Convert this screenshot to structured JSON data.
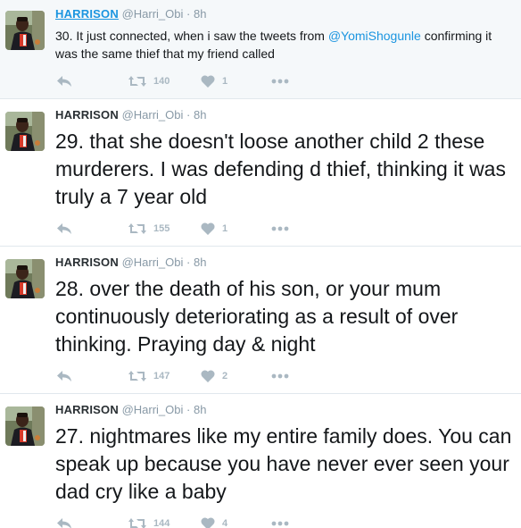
{
  "tweets": [
    {
      "name": "HARRISON",
      "handle": "@Harri_Obi",
      "separator": "·",
      "time": "8h",
      "text_before": "30. It just connected, when i saw the tweets from ",
      "mention": "@YomiShogunle",
      "text_after": " confirming it was the same thief that my friend called",
      "retweets": "140",
      "likes": "1"
    },
    {
      "name": "HARRISON",
      "handle": "@Harri_Obi",
      "separator": "·",
      "time": "8h",
      "text": "29. that she doesn't loose another child 2 these murderers. I was defending d thief, thinking it was truly a 7 year old",
      "retweets": "155",
      "likes": "1"
    },
    {
      "name": "HARRISON",
      "handle": "@Harri_Obi",
      "separator": "·",
      "time": "8h",
      "text": "28. over the death of his son, or your mum continuously deteriorating as a result of over thinking. Praying day & night",
      "retweets": "147",
      "likes": "2"
    },
    {
      "name": "HARRISON",
      "handle": "@Harri_Obi",
      "separator": "·",
      "time": "8h",
      "text": "27. nightmares like my entire family does. You can speak up because you have never ever seen your dad cry like a baby",
      "retweets": "144",
      "likes": "4"
    }
  ],
  "icons": {
    "reply": "reply-icon",
    "retweet": "retweet-icon",
    "like": "heart-icon",
    "more": "more-dots-icon"
  },
  "colors": {
    "link_blue": "#1b95e0",
    "icon_gray": "#aab8c2",
    "meta_gray": "#8899a6",
    "highlight_bg": "#f5f8fa",
    "divider": "#e1e8ed"
  }
}
